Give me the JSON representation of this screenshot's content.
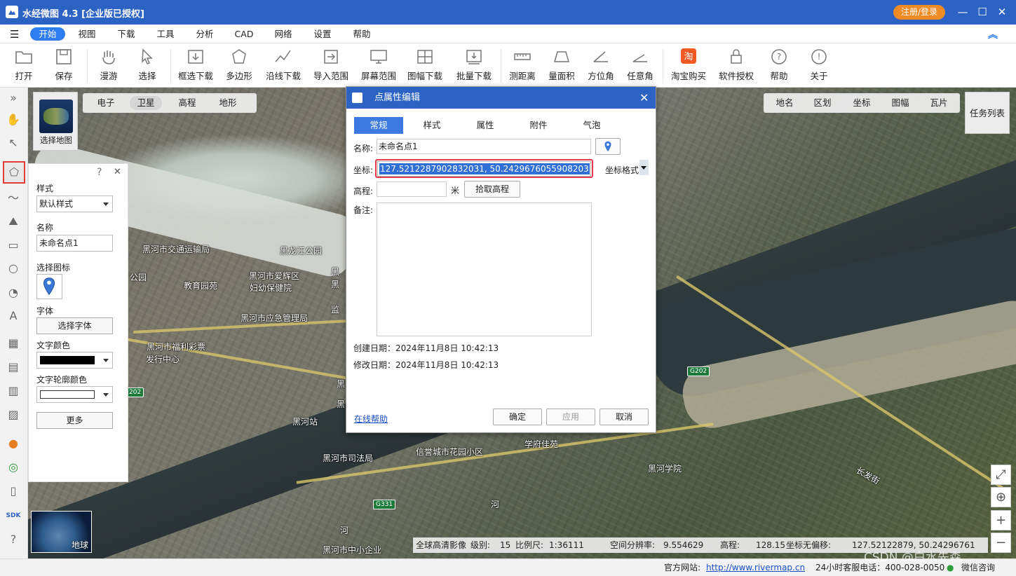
{
  "app": {
    "title": "水经微图 4.3 [企业版已授权]",
    "register": "注册/登录"
  },
  "menu": [
    "开始",
    "视图",
    "下载",
    "工具",
    "分析",
    "CAD",
    "网络",
    "设置",
    "帮助"
  ],
  "toolbar": [
    "打开",
    "保存",
    "漫游",
    "选择",
    "框选下载",
    "多边形",
    "沿线下载",
    "导入范围",
    "屏幕范围",
    "图幅下载",
    "批量下载",
    "测距离",
    "量面积",
    "方位角",
    "任意角",
    "淘宝购买",
    "软件授权",
    "帮助",
    "关于"
  ],
  "map_tabs": [
    "电子",
    "卫星",
    "高程",
    "地形"
  ],
  "right_tabs": [
    "地名",
    "区划",
    "坐标",
    "图幅",
    "瓦片"
  ],
  "task_list": "任务列表",
  "select_map": "选择地图",
  "globe": "地球",
  "side": {
    "help": "?",
    "close": "✕",
    "style_label": "样式",
    "style_value": "默认样式",
    "name_label": "名称",
    "name_value": "未命名点1",
    "icon_label": "选择图标",
    "font_label": "字体",
    "font_button": "选择字体",
    "text_color_label": "文字颜色",
    "outline_color_label": "文字轮廓颜色",
    "more_button": "更多"
  },
  "dialog": {
    "title": "点属性编辑",
    "tabs": [
      "常规",
      "样式",
      "属性",
      "附件",
      "气泡"
    ],
    "name_label": "名称:",
    "name_value": "未命名点1",
    "coord_label": "坐标:",
    "coord_value": "127.5212287902832031, 50.2429676055908203",
    "coord_format": "坐标格式",
    "elev_label": "高程:",
    "elev_unit": "米",
    "elev_button": "拾取高程",
    "note_label": "备注:",
    "created": "创建日期：2024年11月8日 10:42:13",
    "modified": "修改日期：2024年11月8日 10:42:13",
    "help_link": "在线帮助",
    "ok": "确定",
    "apply": "应用",
    "cancel": "取消"
  },
  "map_labels": [
    "黑河市交通运输局",
    "黑龙江公园",
    "黑河市爱辉区",
    "妇幼保健院",
    "教育园苑",
    "黑河市应急管理局",
    "黑河市福利彩票",
    "发行中心",
    "黑河站",
    "黑河市司法局",
    "信誉城市花园小区",
    "学府佳苑",
    "黑河学院",
    "黑河市中小企业",
    "长发街",
    "公园",
    "河",
    "河",
    "黑",
    "黑",
    "监",
    "黑",
    "黑"
  ],
  "shields": [
    "G202",
    "G331",
    "202"
  ],
  "status_info": {
    "layer": "全球高清影像",
    "level_label": "级别:",
    "level": "15",
    "scale_label": "比例尺:",
    "scale": "1:36111",
    "res_label": "空间分辨率:",
    "res": "9.554629",
    "elev_label": "高程:",
    "elev": "128.15",
    "coord_label": "坐标无偏移:",
    "coord": "127.52122879, 50.24296761"
  },
  "statusbar": {
    "site_label": "官方网站:",
    "site": "http://www.rivermap.cn",
    "phone": "24小时客服电话：400-028-0050",
    "wechat": "微信咨询",
    "watermark": "CSDN @白水先森"
  },
  "left_tools": [
    "»",
    "✋",
    "↖",
    "⬠",
    "〜",
    "⛰",
    "▭",
    "○",
    "◔",
    "A",
    "▦",
    "▤",
    "▥",
    "▨",
    "●",
    "◎",
    "▯",
    "SDK",
    "?"
  ],
  "zoom": [
    "⤢",
    "⊕",
    "+",
    "−"
  ]
}
